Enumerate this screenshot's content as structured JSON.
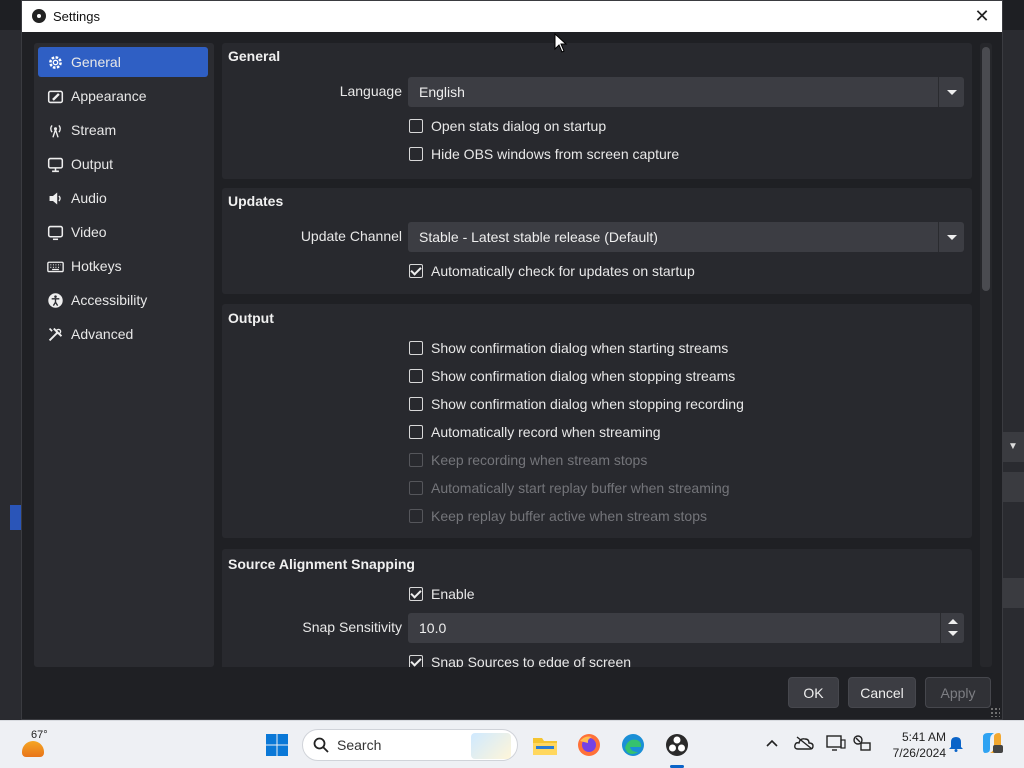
{
  "window": {
    "title": "Settings",
    "close_glyph": "✕"
  },
  "sidebar": {
    "items": [
      {
        "label": "General",
        "icon": "gear-icon",
        "active": true
      },
      {
        "label": "Appearance",
        "icon": "appearance-icon",
        "active": false
      },
      {
        "label": "Stream",
        "icon": "broadcast-icon",
        "active": false
      },
      {
        "label": "Output",
        "icon": "output-icon",
        "active": false
      },
      {
        "label": "Audio",
        "icon": "speaker-icon",
        "active": false
      },
      {
        "label": "Video",
        "icon": "monitor-icon",
        "active": false
      },
      {
        "label": "Hotkeys",
        "icon": "keyboard-icon",
        "active": false
      },
      {
        "label": "Accessibility",
        "icon": "accessibility-icon",
        "active": false
      },
      {
        "label": "Advanced",
        "icon": "tools-icon",
        "active": false
      }
    ]
  },
  "general": {
    "title": "General",
    "language_label": "Language",
    "language_value": "English",
    "open_stats": {
      "label": "Open stats dialog on startup",
      "checked": false
    },
    "hide_obs": {
      "label": "Hide OBS windows from screen capture",
      "checked": false
    }
  },
  "updates": {
    "title": "Updates",
    "channel_label": "Update Channel",
    "channel_value": "Stable - Latest stable release (Default)",
    "auto_check": {
      "label": "Automatically check for updates on startup",
      "checked": true
    }
  },
  "output": {
    "title": "Output",
    "options": [
      {
        "label": "Show confirmation dialog when starting streams",
        "checked": false,
        "disabled": false
      },
      {
        "label": "Show confirmation dialog when stopping streams",
        "checked": false,
        "disabled": false
      },
      {
        "label": "Show confirmation dialog when stopping recording",
        "checked": false,
        "disabled": false
      },
      {
        "label": "Automatically record when streaming",
        "checked": false,
        "disabled": false
      },
      {
        "label": "Keep recording when stream stops",
        "checked": false,
        "disabled": true
      },
      {
        "label": "Automatically start replay buffer when streaming",
        "checked": false,
        "disabled": true
      },
      {
        "label": "Keep replay buffer active when stream stops",
        "checked": false,
        "disabled": true
      }
    ]
  },
  "snapping": {
    "title": "Source Alignment Snapping",
    "enable": {
      "label": "Enable",
      "checked": true
    },
    "sensitivity_label": "Snap Sensitivity",
    "sensitivity_value": "10.0",
    "snap_edges": {
      "label": "Snap Sources to edge of screen",
      "checked": true
    }
  },
  "footer": {
    "ok": "OK",
    "cancel": "Cancel",
    "apply": "Apply",
    "apply_disabled": true
  },
  "taskbar": {
    "temperature": "67°",
    "search_placeholder": "Search",
    "time": "5:41 AM",
    "date": "7/26/2024",
    "pinned": [
      "windows-start-icon",
      "file-explorer-icon",
      "firefox-icon",
      "edge-icon",
      "obs-icon"
    ],
    "tray": [
      "chevron-up-icon",
      "onedrive-icon",
      "display-icon",
      "network-icon",
      "notification-bell-icon",
      "copilot-icon"
    ]
  },
  "colors": {
    "accent": "#2f5fc4",
    "window_bg": "#1f2024",
    "panel_bg": "#28292e",
    "input_bg": "#3c3d43"
  }
}
